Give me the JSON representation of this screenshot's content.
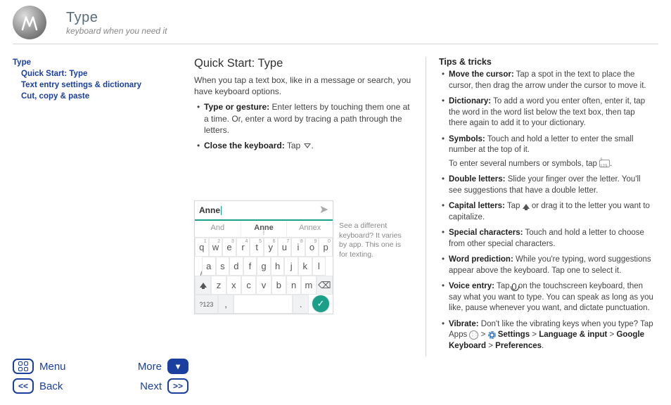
{
  "header": {
    "title": "Type",
    "subtitle": "keyboard when you need it"
  },
  "sidebar": {
    "items": [
      {
        "label": "Type",
        "indent": false
      },
      {
        "label": "Quick Start: Type",
        "indent": true
      },
      {
        "label": "Text entry settings & dictionary",
        "indent": true
      },
      {
        "label": "Cut, copy & paste",
        "indent": true
      }
    ]
  },
  "nav": {
    "menu": "Menu",
    "more": "More",
    "back": "Back",
    "next": "Next"
  },
  "content": {
    "heading": "Quick Start: Type",
    "intro": "When you tap a text box, like in a message or search, you have keyboard options.",
    "bullets": [
      {
        "bold": "Type or gesture:",
        "text": " Enter letters by touching them one at a time. Or, enter a word by tracing a path through the letters."
      },
      {
        "bold": "Close the keyboard:",
        "text": " Tap "
      }
    ],
    "keyboard_note": "See a different keyboard? It varies by app. This one is for texting."
  },
  "keyboard": {
    "input_value": "Anne",
    "suggestions": [
      "And",
      "Anne",
      "Annex"
    ],
    "row1": [
      {
        "k": "q",
        "n": "1"
      },
      {
        "k": "w",
        "n": "2"
      },
      {
        "k": "e",
        "n": "3"
      },
      {
        "k": "r",
        "n": "4"
      },
      {
        "k": "t",
        "n": "5"
      },
      {
        "k": "y",
        "n": "6"
      },
      {
        "k": "u",
        "n": "7"
      },
      {
        "k": "i",
        "n": "8"
      },
      {
        "k": "o",
        "n": "9"
      },
      {
        "k": "p",
        "n": "0"
      }
    ],
    "row2": [
      "a",
      "s",
      "d",
      "f",
      "g",
      "h",
      "j",
      "k",
      "l"
    ],
    "row3": [
      "z",
      "x",
      "c",
      "v",
      "b",
      "n",
      "m"
    ],
    "sym_key": "?123"
  },
  "tips": {
    "heading": "Tips & tricks",
    "items": [
      {
        "bold": "Move the cursor:",
        "text": " Tap a spot in the text to place the cursor, then drag the arrow under the cursor to move it."
      },
      {
        "bold": "Dictionary:",
        "text": " To add a word you enter often, enter it, tap the word in the word list below the text box, then tap there again to add it to your dictionary."
      },
      {
        "bold": "Symbols:",
        "text": " Touch and hold a letter to enter the small number at the top of it.",
        "extra": "To enter several numbers or symbols, tap ",
        "extra_key": "?123"
      },
      {
        "bold": "Double letters:",
        "text": " Slide your finger over the letter. You'll see suggestions that have a double letter."
      },
      {
        "bold": "Capital letters:",
        "text": " Tap ",
        "text2": " or drag it to the letter you want to capitalize.",
        "shift": true
      },
      {
        "bold": "Special characters:",
        "text": " Touch and hold a letter to choose from other special characters."
      },
      {
        "bold": "Word prediction:",
        "text": " While you're typing, word suggestions appear above the keyboard. Tap one to select it."
      },
      {
        "bold": "Voice entry:",
        "text": " Tap ",
        "text2": " on the touchscreen keyboard, then say what you want to type. You can speak as long as you like, pause whenever you want, and dictate punctuation.",
        "mic": true
      },
      {
        "bold": "Vibrate:",
        "text": " Don't like the vibrating keys when you type? Tap Apps ",
        "path": [
          " > ",
          "Settings",
          " > ",
          "Language & input",
          " > ",
          "Google Keyboard",
          " > ",
          "Preferences",
          "."
        ]
      }
    ]
  }
}
